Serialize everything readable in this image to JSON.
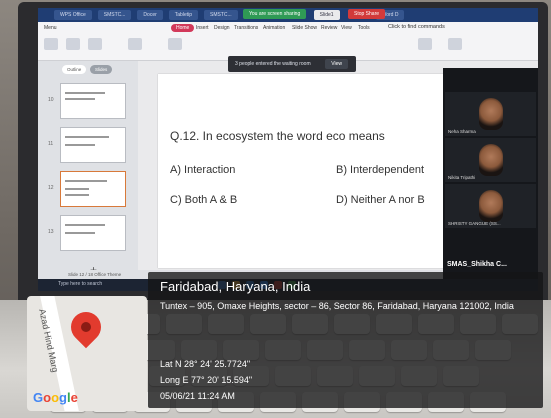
{
  "screen": {
    "tabs": [
      "WPS Office",
      "SMSTC...",
      "Docer",
      "Tabletip",
      "SMSTC...",
      "Slide1",
      "Word D"
    ],
    "share_text": "You are screen sharing",
    "stop_share_label": "Stop Share",
    "menu_items": [
      "Menu",
      "Home",
      "Insert",
      "Design",
      "Transitions",
      "Animation",
      "Slide Show",
      "Review",
      "View",
      "Tools"
    ],
    "find_commands": "Click to find commands",
    "waiting_room_msg": "3 people entered the waiting room",
    "waiting_room_btn": "View",
    "panel_tabs": [
      "Outline",
      "Slides"
    ],
    "slide_numbers": [
      "10",
      "11",
      "12",
      "13"
    ],
    "status_text": "Slide 12 / 18   Office Theme",
    "taskbar_search": "Type here to search"
  },
  "slide": {
    "question": "Q.12. In ecosystem the word eco means",
    "option_a": "A) Interaction",
    "option_b": "B) Interdependent",
    "option_c": "C) Both A & B",
    "option_d": "D) Neither A nor B"
  },
  "participants": [
    {
      "name": "Neha Sharma"
    },
    {
      "name": "Nikita Tripathi"
    },
    {
      "name": "SHRISTY GANGUE (SS..."
    }
  ],
  "self_name": "SMAS_Shikha C...",
  "geotag": {
    "road_label": "Azad Hind Marg",
    "google": "Google",
    "city": "Faridabad, Haryana, India",
    "address": "Tuntex – 905, Omaxe Heights, sector – 86, Sector 86, Faridabad, Haryana 121002, India",
    "lat": "Lat N 28° 24' 25.7724\"",
    "long": "Long E 77° 20' 15.594\"",
    "datetime": "05/06/21 11:24 AM"
  },
  "colors": {
    "pin": "#e23b2e",
    "accent": "#d2395a",
    "taskbar": "#1c2433"
  }
}
